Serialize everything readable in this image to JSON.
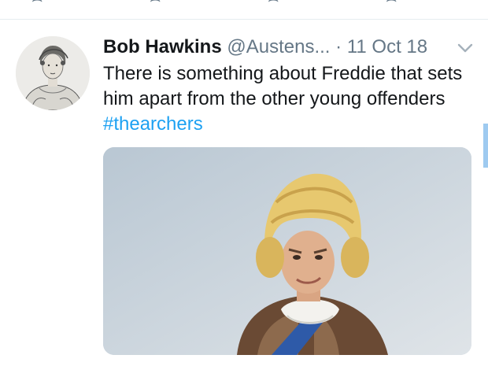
{
  "tweet": {
    "name": "Bob Hawkins",
    "handle": "@Austens...",
    "separator": "·",
    "date": "11 Oct 18",
    "text": "There is something about Freddie that sets him apart from the other young offenders",
    "hashtag": "#thearchers"
  },
  "icons": {
    "avatar": "portrait-avatar",
    "menu": "chevron-down-icon",
    "media": "photo-man-in-powdered-wig"
  },
  "colors": {
    "link": "#1da1f2",
    "secondary": "#657786",
    "text": "#14171a"
  }
}
